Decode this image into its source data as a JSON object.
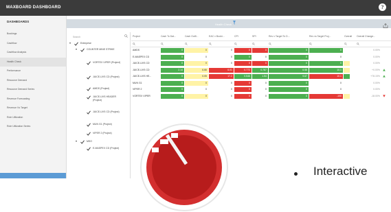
{
  "app": {
    "title": "MAXBOARD DASHBOARD",
    "help_icon": "?"
  },
  "sidebar": {
    "header": "DASHBOARDS",
    "items": [
      {
        "label": "Bookings"
      },
      {
        "label": "Cashflow"
      },
      {
        "label": "Cashflow Analysis"
      },
      {
        "label": "Health Check",
        "active": true
      },
      {
        "label": "Performance"
      },
      {
        "label": "Resource Demand"
      },
      {
        "label": "Resource Demand Series"
      },
      {
        "label": "Revenue Forecasting"
      },
      {
        "label": "Revenue Vs Target"
      },
      {
        "label": "Role Utilization"
      },
      {
        "label": "Role Utilization Series"
      }
    ]
  },
  "panel": {
    "title": "Health Check",
    "tree_search_placeholder": "Search"
  },
  "tree": [
    {
      "label": "Enterprise",
      "level": 0,
      "expanded": true
    },
    {
      "label": "COUNTER MINE STRIKE",
      "level": 1,
      "expanded": true
    },
    {
      "label": "VORTEX VIPER (Project)",
      "level": 2
    },
    {
      "label": "JUICE-UVS CD (Project)",
      "level": 2
    },
    {
      "label": "AMDS (Project)",
      "level": 2
    },
    {
      "label": "JUICE-UVS HEADER (Project)",
      "level": 2
    },
    {
      "label": "JUICE-UVS CD (Project)",
      "level": 2
    },
    {
      "label": "MUN G1 (Project)",
      "level": 2
    },
    {
      "label": "VIPER 2 (Project)",
      "level": 2
    },
    {
      "label": "MSO",
      "level": 1,
      "expanded": true
    },
    {
      "label": "E-MASPEX CD (Project)",
      "level": 2
    }
  ],
  "table": {
    "columns": [
      "Project",
      "Cash To Dat...",
      "Cash Outfl...",
      "EAC v Booki...",
      "CPI",
      "SPI",
      "Rev v Target To D...",
      "Rev vs Target Proj...",
      "Overall",
      "Overall Change..."
    ],
    "rows": [
      {
        "name": "AMDS",
        "cells": [
          "0",
          "0",
          "0",
          "0",
          "0",
          "0",
          "0"
        ],
        "change": "0.00%",
        "trend": ""
      },
      {
        "name": "E-MASPEX CD",
        "cells": [
          "0",
          "0",
          "0",
          "0",
          "0",
          "0",
          "0"
        ],
        "change": "0.00%",
        "trend": ""
      },
      {
        "name": "JUICE-UVS CD",
        "cells": [
          "0",
          "0",
          "0",
          "0",
          "0",
          "0",
          "0"
        ],
        "change": "0.00%",
        "trend": ""
      },
      {
        "name": "JUICE-UVS CD",
        "cells": [
          "2.14",
          "6.66",
          "6.01",
          "0.772",
          "0.787",
          "6.58",
          "10.1"
        ],
        "change": "+0.00%",
        "trend": "up"
      },
      {
        "name": "JUICE-UVS HE...",
        "cells": [
          "0",
          "0.05",
          "17.2",
          "0.546",
          "1.54",
          "9.67",
          "10.1"
        ],
        "change": "+78.15%",
        "trend": "up"
      },
      {
        "name": "MUN G1",
        "cells": [
          "0",
          "0",
          "0",
          "0",
          "0",
          "0",
          "0"
        ],
        "change": "0.00%",
        "trend": ""
      },
      {
        "name": "VIPER 2",
        "cells": [
          "0",
          "0",
          "0",
          "0",
          "0",
          "0",
          "0"
        ],
        "change": "0.00%",
        "trend": ""
      },
      {
        "name": "VORTEX VIPER",
        "cells": [
          "0",
          "0",
          "0",
          "0",
          "0",
          "0",
          "-100"
        ],
        "change": "-18.00%",
        "trend": "down"
      }
    ]
  },
  "promo": {
    "bullet": "Interactive"
  },
  "colors": {
    "green": "#4caf50",
    "yellow": "#fff3a6",
    "red": "#e53935",
    "up": "#4caf50",
    "down": "#e53935",
    "accent": "#5b9bd5"
  }
}
